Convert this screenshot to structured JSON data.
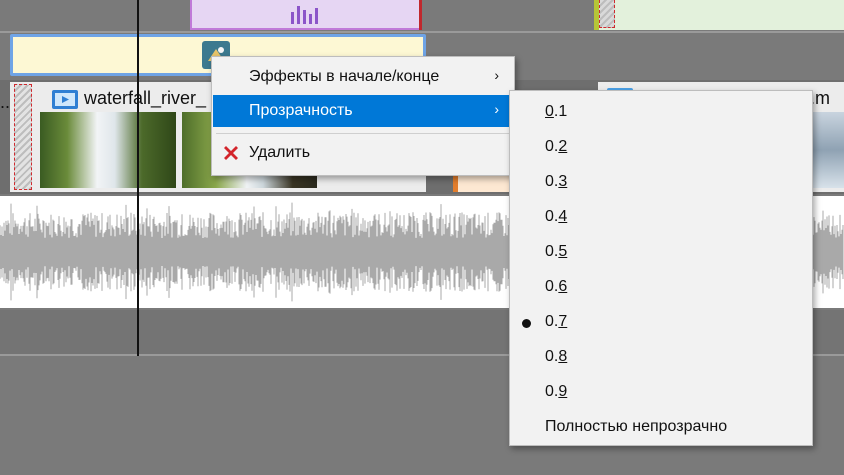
{
  "timeline": {
    "video_clip_name": "waterfall_river_",
    "right_clip_name_fragment": "d.m"
  },
  "context_menu": {
    "items": [
      {
        "label": "Эффекты в начале/конце",
        "has_submenu": true
      },
      {
        "label": "Прозрачность",
        "has_submenu": true,
        "highlighted": true
      },
      {
        "label": "Удалить",
        "icon": "red-x-icon"
      }
    ],
    "submenu_arrow": "›"
  },
  "opacity_submenu": {
    "selected": "0.7",
    "items": [
      {
        "prefix": "0",
        "rest": ".1"
      },
      {
        "prefix": "0.",
        "rest": "2"
      },
      {
        "prefix": "0.",
        "rest": "3"
      },
      {
        "prefix": "0.",
        "rest": "4"
      },
      {
        "prefix": "0.",
        "rest": "5"
      },
      {
        "prefix": "0.",
        "rest": "6"
      },
      {
        "prefix": "0.",
        "rest": "7"
      },
      {
        "prefix": "0.",
        "rest": "8"
      },
      {
        "prefix": "0.",
        "rest": "9"
      },
      {
        "prefix": "",
        "rest": "Полностью непрозрачно"
      }
    ]
  },
  "colors": {
    "highlight": "#0078d7",
    "delete_icon": "#d3252b"
  }
}
